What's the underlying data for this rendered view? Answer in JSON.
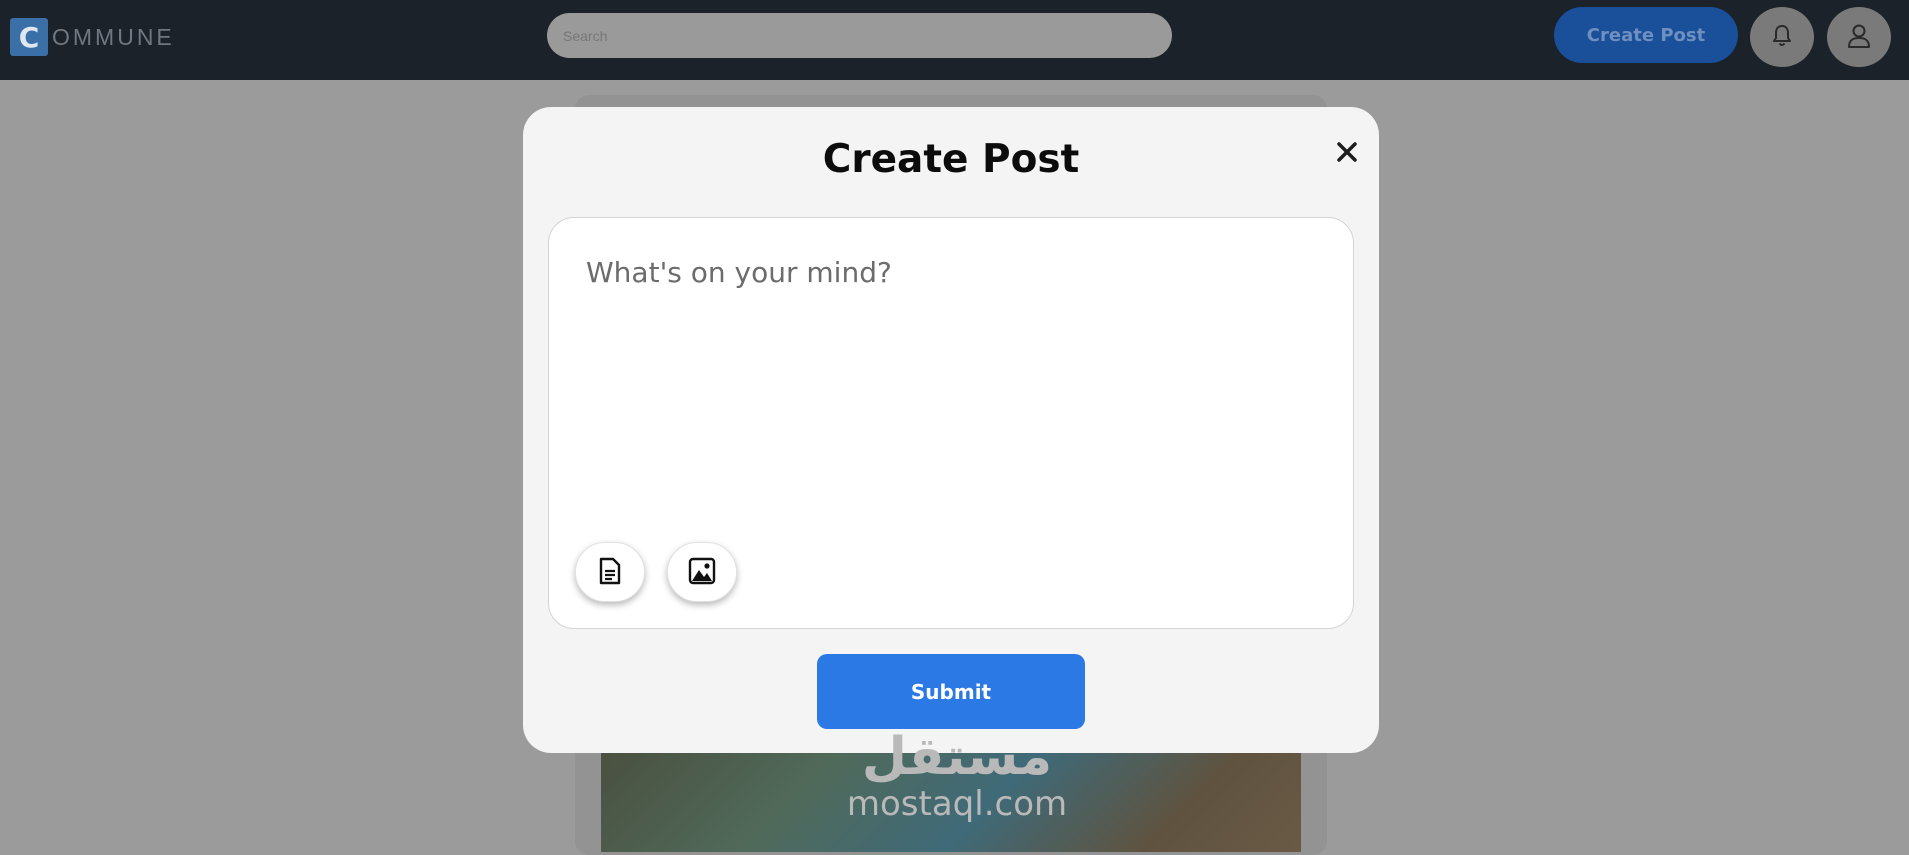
{
  "header": {
    "logo_letter": "C",
    "logo_text": "OMMUNE",
    "search_placeholder": "Search",
    "create_post_label": "Create Post",
    "icons": {
      "notifications": "bell-icon",
      "profile": "user-icon"
    },
    "colors": {
      "background": "#1b2229",
      "create_button": "#1a4f99"
    }
  },
  "modal": {
    "title": "Create Post",
    "close_icon": "close-icon",
    "editor_placeholder": "What's on your mind?",
    "attach_file_icon": "document-icon",
    "attach_image_icon": "image-icon",
    "submit_label": "Submit",
    "colors": {
      "submit": "#2b79e4",
      "modal_bg": "#f4f4f4"
    }
  },
  "watermark": {
    "arabic": "مستقل",
    "latin": "mostaql.com"
  }
}
